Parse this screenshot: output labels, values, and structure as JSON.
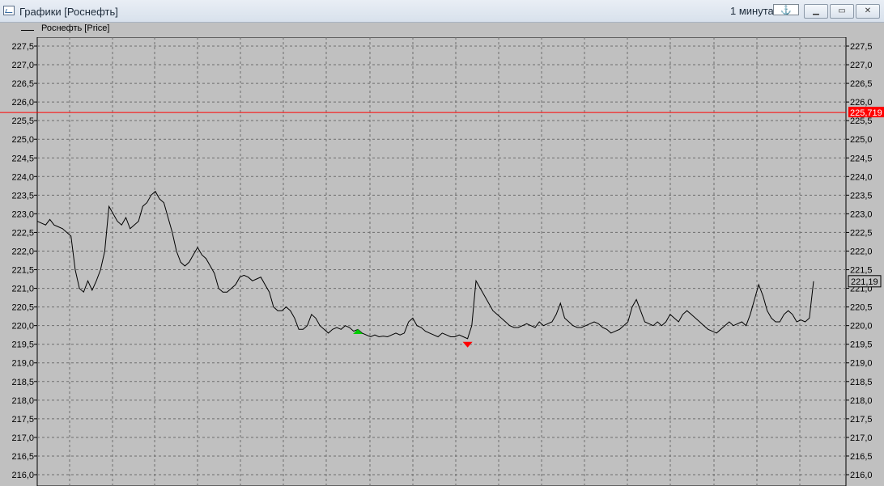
{
  "window": {
    "title": "Графики [Роснефть]",
    "interval_label": "1 минута",
    "anchor_icon": "anchor-icon",
    "buttons": [
      "minimize-icon",
      "restore-icon",
      "close-icon"
    ]
  },
  "legend": {
    "label": "Роснефть [Price]"
  },
  "markers": {
    "level_value": "225,719",
    "last_price": "221,19"
  },
  "colors": {
    "background": "#c0c0c0",
    "line": "#000000",
    "level_line": "#ff0000",
    "buy_marker": "#00cc00",
    "sell_marker": "#ff0000"
  },
  "chart_data": {
    "type": "line",
    "grid": true,
    "ylim": [
      215.7,
      227.9
    ],
    "ticks": [
      "227,5",
      "227,0",
      "226,5",
      "226,0",
      "225,5",
      "225,0",
      "224,5",
      "224,0",
      "223,5",
      "223,0",
      "222,5",
      "222,0",
      "221,5",
      "221,0",
      "220,5",
      "220,0",
      "219,5",
      "219,0",
      "218,5",
      "218,0",
      "217,5",
      "217,0",
      "216,5",
      "216,0"
    ],
    "tick_values": [
      227.5,
      227.0,
      226.5,
      226.0,
      225.5,
      225.0,
      224.5,
      224.0,
      223.5,
      223.0,
      222.5,
      222.0,
      221.5,
      221.0,
      220.5,
      220.0,
      219.5,
      219.0,
      218.5,
      218.0,
      217.5,
      217.0,
      216.5,
      216.0
    ],
    "level": 225.719,
    "last": 221.19,
    "series": [
      {
        "values": [
          222.8,
          222.75,
          222.7,
          222.85,
          222.7,
          222.65,
          222.6,
          222.5,
          222.4,
          221.5,
          221.0,
          220.9,
          221.2,
          220.95,
          221.2,
          221.5,
          222.0,
          223.2,
          223.0,
          222.8,
          222.7,
          222.9,
          222.6,
          222.7,
          222.8,
          223.2,
          223.3,
          223.5,
          223.6,
          223.4,
          223.3,
          222.9,
          222.5,
          222.0,
          221.7,
          221.6,
          221.7,
          221.9,
          222.1,
          221.9,
          221.8,
          221.6,
          221.4,
          221.0,
          220.9,
          220.9,
          221.0,
          221.1,
          221.3,
          221.35,
          221.3,
          221.2,
          221.25,
          221.3,
          221.1,
          220.9,
          220.5,
          220.4,
          220.4,
          220.5,
          220.4,
          220.2,
          219.9,
          219.9,
          220.0,
          220.3,
          220.2,
          220.0,
          219.9,
          219.8,
          219.9,
          219.95,
          219.9,
          220.0,
          219.95,
          219.85,
          219.9,
          219.8,
          219.75,
          219.7,
          219.75,
          219.7,
          219.72,
          219.7,
          219.75,
          219.8,
          219.75,
          219.8,
          220.1,
          220.2,
          220.0,
          219.95,
          219.85,
          219.8,
          219.75,
          219.7,
          219.8,
          219.75,
          219.7,
          219.7,
          219.75,
          219.7,
          219.65,
          220.0,
          221.2,
          221.0,
          220.8,
          220.6,
          220.4,
          220.3,
          220.2,
          220.1,
          220.0,
          219.95,
          219.95,
          220.0,
          220.05,
          220.0,
          219.95,
          220.1,
          220.0,
          220.05,
          220.1,
          220.3,
          220.6,
          220.2,
          220.1,
          220.0,
          219.95,
          219.95,
          220.0,
          220.05,
          220.1,
          220.05,
          219.95,
          219.9,
          219.8,
          219.85,
          219.9,
          220.0,
          220.1,
          220.5,
          220.7,
          220.4,
          220.1,
          220.05,
          220.0,
          220.1,
          220.0,
          220.1,
          220.3,
          220.2,
          220.1,
          220.3,
          220.4,
          220.3,
          220.2,
          220.1,
          220.0,
          219.9,
          219.85,
          219.8,
          219.9,
          220.0,
          220.1,
          220.0,
          220.05,
          220.1,
          220.0,
          220.3,
          220.7,
          221.1,
          220.8,
          220.4,
          220.2,
          220.1,
          220.1,
          220.3,
          220.4,
          220.3,
          220.1,
          220.15,
          220.1,
          220.2,
          221.19
        ]
      }
    ],
    "trade_markers": [
      {
        "type": "buy",
        "index": 76,
        "value": 219.82
      },
      {
        "type": "sell",
        "index": 102,
        "value": 219.5
      }
    ]
  }
}
